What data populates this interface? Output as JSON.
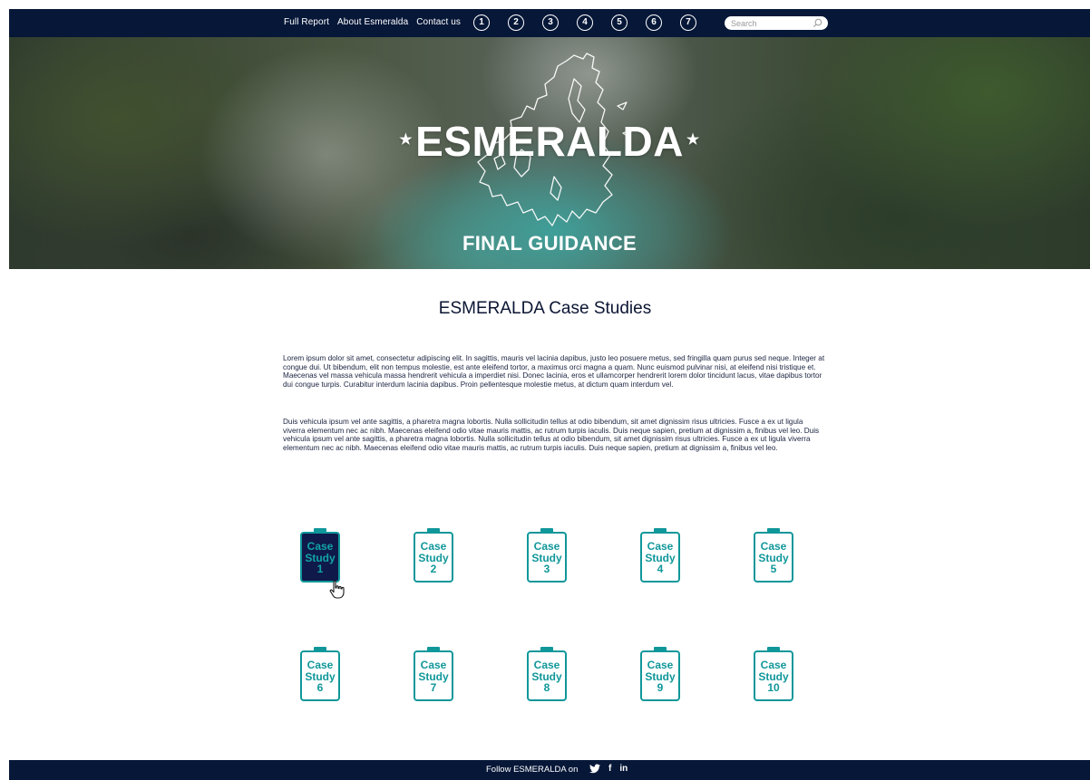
{
  "nav": {
    "links": [
      "Full Report",
      "About Esmeralda",
      "Contact us"
    ],
    "numbers": [
      "1",
      "2",
      "3",
      "4",
      "5",
      "6",
      "7"
    ],
    "search_placeholder": "Search"
  },
  "hero": {
    "title": "ESMERALDA",
    "star": "★",
    "subtitle": "FINAL GUIDANCE"
  },
  "main": {
    "title": "ESMERALDA Case Studies",
    "paragraphs": [
      "Lorem ipsum dolor sit amet, consectetur adipiscing elit. In sagittis, mauris vel lacinia dapibus, justo leo posuere metus, sed fringilla quam purus sed neque. Integer at congue dui. Ut bibendum, elit non tempus molestie, est ante eleifend tortor, a maximus orci magna a quam. Nunc euismod pulvinar nisi, at eleifend nisi tristique et. Maecenas vel massa vehicula massa hendrerit vehicula a imperdiet nisi. Donec lacinia, eros et ullamcorper hendrerit lorem dolor tincidunt lacus, vitae dapibus tortor dui congue turpis. Curabitur interdum lacinia dapibus. Proin pellentesque molestie metus, at dictum quam interdum vel.",
      "Duis vehicula ipsum vel ante sagittis, a pharetra magna lobortis. Nulla sollicitudin tellus at odio bibendum, sit amet dignissim risus ultricies. Fusce a ex ut ligula viverra elementum nec ac nibh. Maecenas eleifend odio vitae mauris mattis, ac rutrum turpis iaculis. Duis neque sapien, pretium at dignissim a, finibus vel leo. Duis vehicula ipsum vel ante sagittis, a pharetra magna lobortis. Nulla sollicitudin tellus at odio bibendum, sit amet dignissim risus ultricies. Fusce a ex ut ligula viverra elementum nec ac nibh. Maecenas eleifend odio vitae mauris mattis, ac rutrum turpis iaculis. Duis neque sapien, pretium at dignissim a, finibus vel leo."
    ],
    "case_studies": [
      {
        "line1": "Case",
        "line2": "Study",
        "num": "1",
        "active": true
      },
      {
        "line1": "Case",
        "line2": "Study",
        "num": "2"
      },
      {
        "line1": "Case",
        "line2": "Study",
        "num": "3"
      },
      {
        "line1": "Case",
        "line2": "Study",
        "num": "4"
      },
      {
        "line1": "Case",
        "line2": "Study",
        "num": "5"
      },
      {
        "line1": "Case",
        "line2": "Study",
        "num": "6"
      },
      {
        "line1": "Case",
        "line2": "Study",
        "num": "7"
      },
      {
        "line1": "Case",
        "line2": "Study",
        "num": "8"
      },
      {
        "line1": "Case",
        "line2": "Study",
        "num": "9"
      },
      {
        "line1": "Case",
        "line2": "Study",
        "num": "10"
      }
    ]
  },
  "footer": {
    "follow_text": "Follow ESMERALDA on",
    "social_icons": [
      "twitter-icon",
      "facebook-icon",
      "linkedin-icon"
    ],
    "facebook_glyph": "f",
    "linkedin_glyph": "in"
  },
  "colors": {
    "nav_bg": "#061738",
    "accent_teal": "#10979a",
    "active_card_bg": "#0f1a4a",
    "text_dark": "#0b1533"
  }
}
